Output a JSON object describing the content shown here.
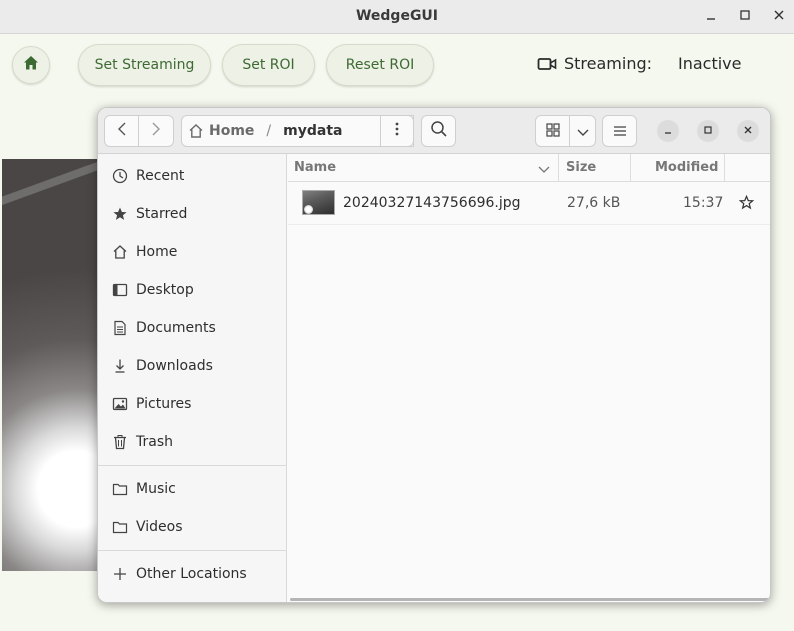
{
  "window": {
    "title": "WedgeGUI"
  },
  "toolbar": {
    "set_streaming": "Set Streaming",
    "set_roi": "Set ROI",
    "reset_roi": "Reset ROI",
    "streaming_label": "Streaming:",
    "streaming_status": "Inactive"
  },
  "dialog": {
    "path": {
      "home": "Home",
      "separator": "/",
      "current": "mydata"
    },
    "sidebar": {
      "places": [
        {
          "label": "Recent",
          "icon": "clock-icon"
        },
        {
          "label": "Starred",
          "icon": "star-icon"
        },
        {
          "label": "Home",
          "icon": "home-icon"
        },
        {
          "label": "Desktop",
          "icon": "desktop-icon"
        },
        {
          "label": "Documents",
          "icon": "document-icon"
        },
        {
          "label": "Downloads",
          "icon": "download-icon"
        },
        {
          "label": "Pictures",
          "icon": "picture-icon"
        },
        {
          "label": "Trash",
          "icon": "trash-icon"
        }
      ],
      "bookmarks": [
        {
          "label": "Music",
          "icon": "folder-icon"
        },
        {
          "label": "Videos",
          "icon": "folder-icon"
        }
      ],
      "other_locations": "Other Locations"
    },
    "columns": {
      "name": "Name",
      "size": "Size",
      "modified": "Modified"
    },
    "files": [
      {
        "name": "20240327143756696.jpg",
        "size": "27,6 kB",
        "modified": "15:37"
      }
    ]
  },
  "colors": {
    "accent_green": "#3d6a33",
    "app_background": "#f5f8ee"
  }
}
